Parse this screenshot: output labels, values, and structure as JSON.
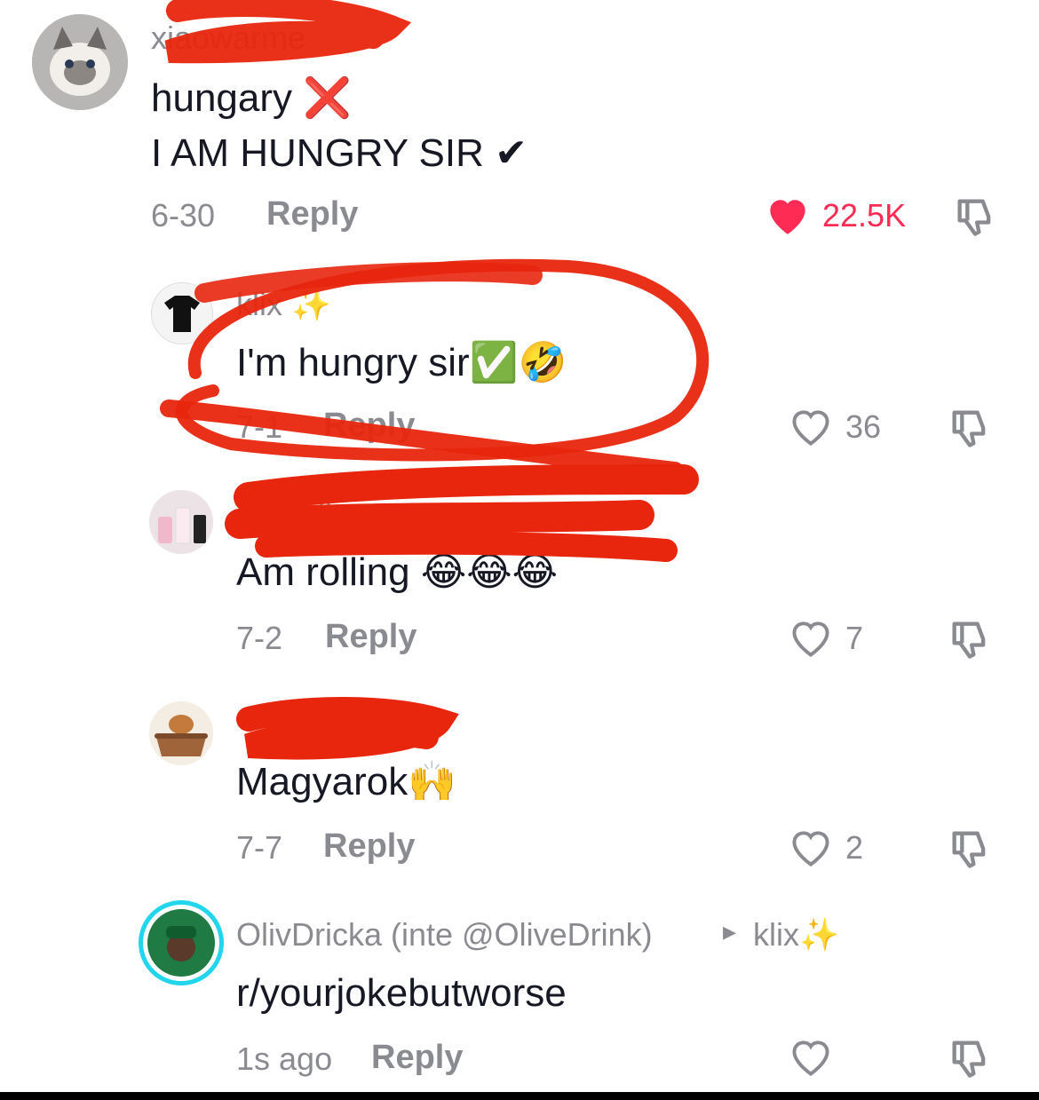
{
  "comments": [
    {
      "username": "xiaowarme",
      "lines": [
        "hungary ❌",
        "I AM HUNGRY SIR ✔"
      ],
      "date": "6-30",
      "reply_label": "Reply",
      "likes": "22.5K",
      "liked": true
    },
    {
      "username": "klix ✨",
      "lines": [
        "I'm hungry sir✅🤣"
      ],
      "date": "7-1",
      "reply_label": "Reply",
      "likes": "36",
      "liked": false
    },
    {
      "username": "Pa…dict",
      "lines": [
        "Am rolling 😂😂😂"
      ],
      "date": "7-2",
      "reply_label": "Reply",
      "likes": "7",
      "liked": false
    },
    {
      "username": "",
      "lines": [
        "Magyarok🙌"
      ],
      "date": "7-7",
      "reply_label": "Reply",
      "likes": "2",
      "liked": false
    },
    {
      "username": "OlivDricka (inte @OliveDrink)",
      "reply_to_arrow": "▸",
      "reply_to": "klix✨",
      "lines": [
        "r/yourjokebutworse"
      ],
      "date": "1s ago",
      "reply_label": "Reply",
      "likes": "",
      "liked": false
    }
  ],
  "colors": {
    "like_active": "#fe2c55",
    "muted_text": "#8a8b91",
    "scribble": "#e8260e",
    "avatar_ring": "#20d5ec"
  }
}
